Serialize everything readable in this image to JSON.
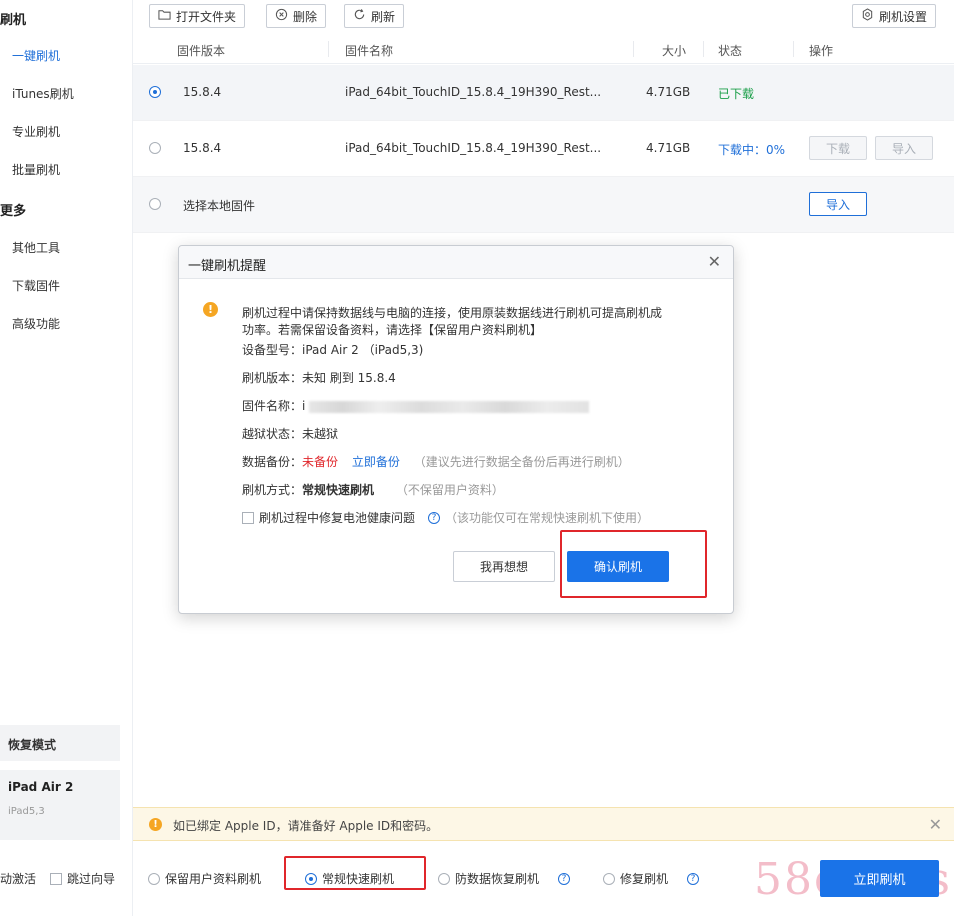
{
  "sidebar": {
    "group_flash": "刷机",
    "items_flash": [
      "一键刷机",
      "iTunes刷机",
      "专业刷机",
      "批量刷机"
    ],
    "group_more": "更多",
    "items_more": [
      "其他工具",
      "下载固件",
      "高级功能"
    ],
    "mode_label": "恢复模式",
    "device_name": "iPad Air 2",
    "device_model": "iPad5,3"
  },
  "toolbar": {
    "open_folder": "打开文件夹",
    "delete": "删除",
    "refresh": "刷新",
    "settings": "刷机设置"
  },
  "table": {
    "headers": [
      "固件版本",
      "固件名称",
      "大小",
      "状态",
      "操作"
    ],
    "rows": [
      {
        "version": "15.8.4",
        "name": "iPad_64bit_TouchID_15.8.4_19H390_Rest...",
        "size": "4.71GB",
        "status": "已下载"
      },
      {
        "version": "15.8.4",
        "name": "iPad_64bit_TouchID_15.8.4_19H390_Rest...",
        "size": "4.71GB",
        "status": "下载中：0%",
        "btn_download": "下载",
        "btn_import": "导入"
      }
    ],
    "local": {
      "label": "选择本地固件",
      "btn_import": "导入"
    }
  },
  "dialog": {
    "title": "一键刷机提醒",
    "warn_line1": "刷机过程中请保持数据线与电脑的连接，使用原装数据线进行刷机可提高刷机成",
    "warn_line2": "功率。若需保留设备资料，请选择【保留用户资料刷机】",
    "model_label": "设备型号：",
    "model_value": "iPad Air 2 （iPad5,3)",
    "version_label": "刷机版本：",
    "version_value": "未知 刷到 15.8.4",
    "fw_label": "固件名称：",
    "fw_value": "i",
    "jb_label": "越狱状态：",
    "jb_value": "未越狱",
    "backup_label": "数据备份：",
    "backup_value": "未备份",
    "backup_link": "立即备份",
    "backup_hint": "（建议先进行数据全备份后再进行刷机）",
    "method_label": "刷机方式：",
    "method_value": "常规快速刷机",
    "method_hint": "（不保留用户资料）",
    "battery_label": "刷机过程中修复电池健康问题",
    "battery_hint": "（该功能仅可在常规快速刷机下使用）",
    "btn_cancel": "我再想想",
    "btn_confirm": "确认刷机"
  },
  "notice": {
    "text": "如已绑定 Apple ID，请准备好 Apple ID和密码。"
  },
  "footer": {
    "auto_activate": "动激活",
    "skip_guide": "跳过向导",
    "opt_keep": "保留用户资料刷机",
    "opt_fast": "常规快速刷机",
    "opt_anti": "防数据恢复刷机",
    "opt_repair": "修复刷机",
    "btn_flash": "立即刷机",
    "watermark": "58codes"
  },
  "colors": {
    "accent": "#1a73e8",
    "success": "#1a9e48",
    "danger": "#e0262b",
    "warning": "#f5a623"
  }
}
